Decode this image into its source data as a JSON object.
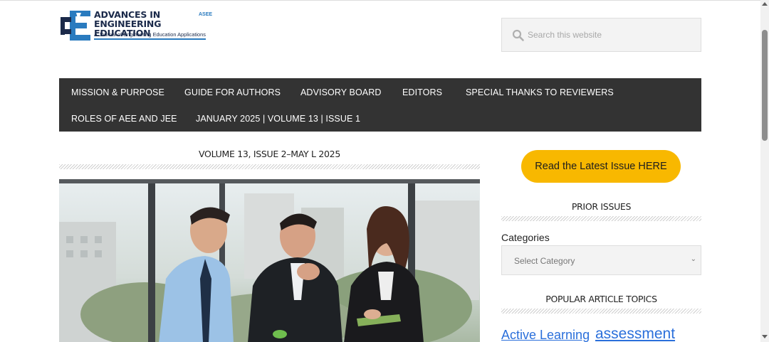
{
  "header": {
    "logo": {
      "title_line1": "ADVANCES IN",
      "title_line2": "ENGINEERING EDUCATION",
      "asee": "ASEE",
      "subtitle": "A Journal of Engineering Education Applications"
    },
    "search": {
      "placeholder": "Search this website",
      "icon": "search-icon"
    }
  },
  "nav": {
    "items": [
      {
        "label": "MISSION & PURPOSE"
      },
      {
        "label": "GUIDE FOR AUTHORS"
      },
      {
        "label": "ADVISORY BOARD"
      },
      {
        "label": "EDITORS"
      },
      {
        "label": "SPECIAL THANKS TO REVIEWERS"
      },
      {
        "label": "ROLES OF AEE AND JEE"
      },
      {
        "label": "JANUARY 2025 | VOLUME 13 | ISSUE 1"
      }
    ]
  },
  "main": {
    "title": "VOLUME 13, ISSUE 2–MAY L 2025"
  },
  "sidebar": {
    "latest_button": "Read the Latest Issue HERE",
    "prior_issues_title": "PRIOR ISSUES",
    "categories_label": "Categories",
    "categories_select": "Select Category",
    "popular_title": "POPULAR ARTICLE TOPICS",
    "tags": [
      {
        "label": "Active Learning"
      },
      {
        "label": "assessment"
      }
    ]
  },
  "colors": {
    "nav_bg": "#333333",
    "accent_button": "#f8b800",
    "link": "#2a6fdb",
    "logo_blue": "#2a7bbf"
  }
}
